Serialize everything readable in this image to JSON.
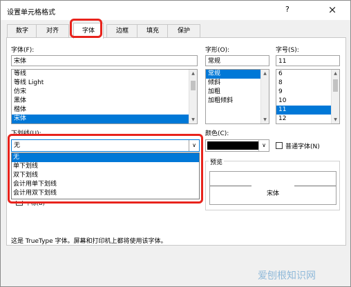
{
  "window": {
    "title": "设置单元格格式",
    "help": "?",
    "close": "×"
  },
  "tabs": [
    {
      "label": "数字"
    },
    {
      "label": "对齐"
    },
    {
      "label": "字体"
    },
    {
      "label": "边框"
    },
    {
      "label": "填充"
    },
    {
      "label": "保护"
    }
  ],
  "font": {
    "label": "字体(F):",
    "value": "宋体",
    "items": [
      "等线",
      "等线 Light",
      "仿宋",
      "黑体",
      "楷体",
      "宋体"
    ],
    "selected": "宋体"
  },
  "style": {
    "label": "字形(O):",
    "value": "常规",
    "items": [
      "常规",
      "倾斜",
      "加粗",
      "加粗倾斜"
    ],
    "selected": "常规"
  },
  "size": {
    "label": "字号(S):",
    "value": "11",
    "items": [
      "6",
      "8",
      "9",
      "10",
      "11",
      "12"
    ],
    "selected": "11"
  },
  "underline": {
    "label": "下划线(U):",
    "value": "无",
    "options": [
      "无",
      "单下划线",
      "双下划线",
      "会计用单下划线",
      "会计用双下划线"
    ],
    "selected": "无"
  },
  "color": {
    "label": "颜色(C):",
    "value_color": "#000000"
  },
  "normal_font": {
    "label": "普通字体(N)"
  },
  "effects": {
    "partial_label": "下标(B)"
  },
  "preview": {
    "label": "预览",
    "text": "宋体"
  },
  "note": "这是 TrueType 字体。屏幕和打印机上都将使用该字体。",
  "watermark": "爱刨根知识网",
  "colors": {
    "accent": "#0078d7",
    "highlight": "#e8231c"
  }
}
